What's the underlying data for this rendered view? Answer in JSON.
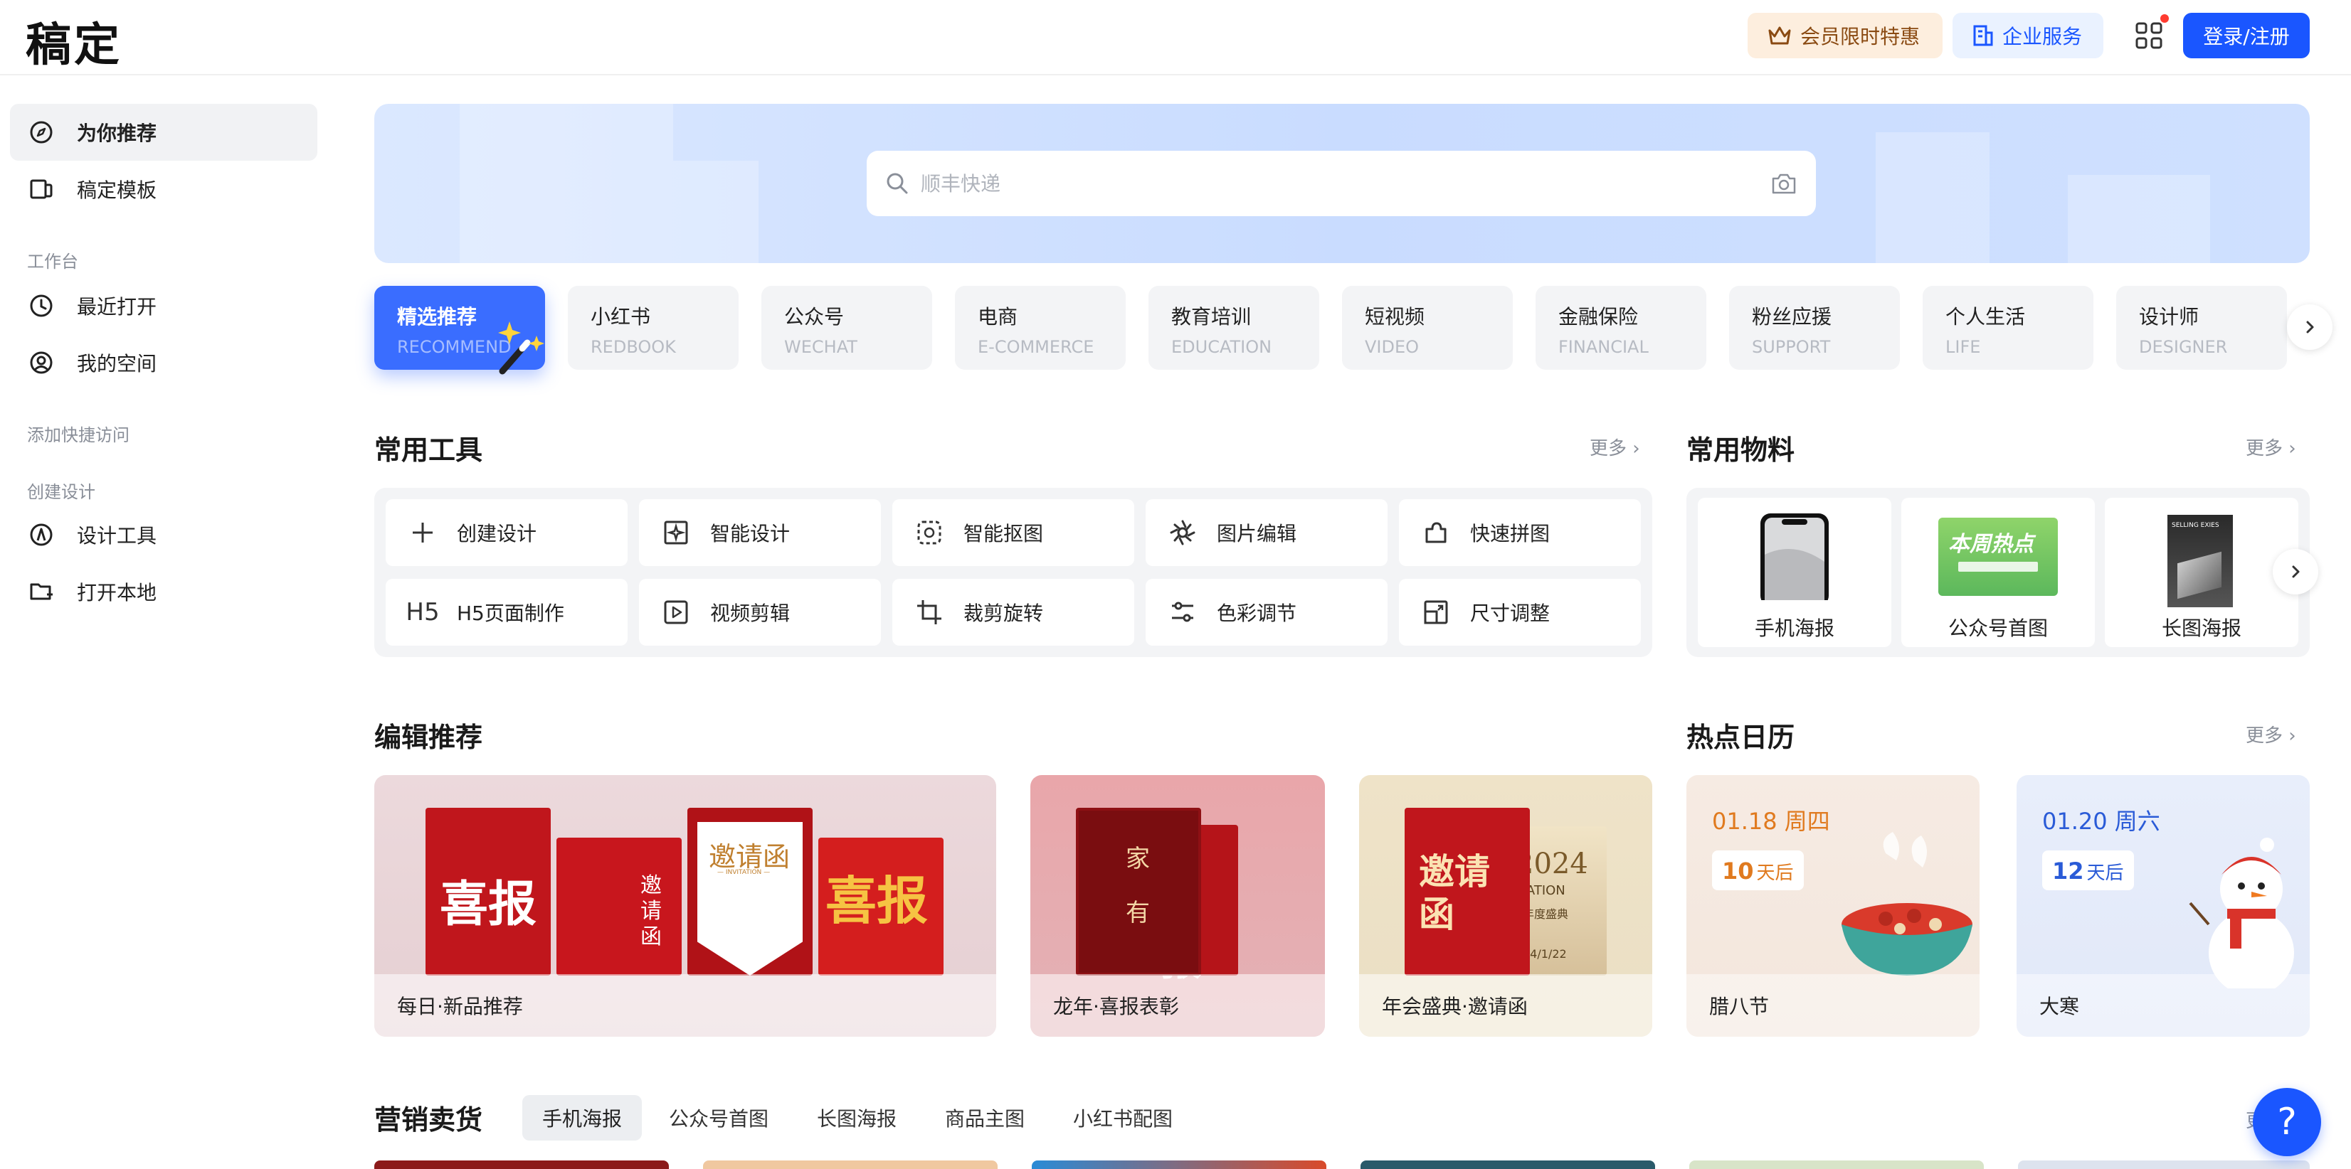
{
  "header": {
    "logo": "稿定",
    "vip_label": "会员限时特惠",
    "enterprise_label": "企业服务",
    "login_label": "登录/注册"
  },
  "sidebar": {
    "items_top": [
      {
        "label": "为你推荐",
        "icon": "compass-icon",
        "active": true
      },
      {
        "label": "稿定模板",
        "icon": "template-icon",
        "active": false
      }
    ],
    "section_workbench": "工作台",
    "items_workbench": [
      {
        "label": "最近打开",
        "icon": "clock-icon"
      },
      {
        "label": "我的空间",
        "icon": "user-circle-icon"
      }
    ],
    "section_quick": "添加快捷访问",
    "section_create": "创建设计",
    "items_create": [
      {
        "label": "设计工具",
        "icon": "pen-tool-icon"
      },
      {
        "label": "打开本地",
        "icon": "folder-add-icon"
      }
    ]
  },
  "search": {
    "placeholder": "顺丰快递"
  },
  "categories": [
    {
      "cn": "精选推荐",
      "en": "RECOMMEND",
      "active": true
    },
    {
      "cn": "小红书",
      "en": "REDBOOK"
    },
    {
      "cn": "公众号",
      "en": "WECHAT"
    },
    {
      "cn": "电商",
      "en": "E-COMMERCE"
    },
    {
      "cn": "教育培训",
      "en": "EDUCATION"
    },
    {
      "cn": "短视频",
      "en": "VIDEO"
    },
    {
      "cn": "金融保险",
      "en": "FINANCIAL"
    },
    {
      "cn": "粉丝应援",
      "en": "SUPPORT"
    },
    {
      "cn": "个人生活",
      "en": "LIFE"
    },
    {
      "cn": "设计师",
      "en": "DESIGNER"
    }
  ],
  "tools": {
    "title": "常用工具",
    "more": "更多",
    "items": [
      {
        "label": "创建设计",
        "icon": "plus-icon"
      },
      {
        "label": "智能设计",
        "icon": "ai-design-icon"
      },
      {
        "label": "智能抠图",
        "icon": "cutout-icon"
      },
      {
        "label": "图片编辑",
        "icon": "image-edit-icon"
      },
      {
        "label": "快速拼图",
        "icon": "puzzle-icon"
      },
      {
        "label": "H5页面制作",
        "icon": "h5-icon",
        "glyph": "H5"
      },
      {
        "label": "视频剪辑",
        "icon": "video-play-icon"
      },
      {
        "label": "裁剪旋转",
        "icon": "crop-icon"
      },
      {
        "label": "色彩调节",
        "icon": "sliders-icon"
      },
      {
        "label": "尺寸调整",
        "icon": "resize-icon"
      }
    ]
  },
  "materials": {
    "title": "常用物料",
    "more": "更多",
    "items": [
      "手机海报",
      "公众号首图",
      "长图海报"
    ],
    "thumb_texts": [
      "SELLING EXIES",
      "本周热点"
    ]
  },
  "editorial": {
    "title": "编辑推荐",
    "items": [
      "每日·新品推荐",
      "龙年·喜报表彰",
      "年会盛典·邀请函"
    ],
    "poster_texts": {
      "xibao": "喜报",
      "yaoqinghan": "邀请函",
      "yaoqing_short": "邀\n请\n函",
      "invitation": "— INVITATION —",
      "jia": "家",
      "you": "有",
      "year_2024": "2024",
      "itation": "ITATION",
      "nianduchengdian": "年度盛典",
      "date_short": "24/1/22"
    }
  },
  "hot": {
    "title": "热点日历",
    "more": "更多",
    "items": [
      {
        "date": "01.18 周四",
        "count": "10",
        "suffix": "天后",
        "name": "腊八节",
        "color": "#e07a1f"
      },
      {
        "date": "01.20 周六",
        "count": "12",
        "suffix": "天后",
        "name": "大寒",
        "color": "#2a5bd7"
      }
    ]
  },
  "marketing": {
    "title": "营销卖货",
    "tabs": [
      "手机海报",
      "公众号首图",
      "长图海报",
      "商品主图",
      "小红书配图"
    ],
    "more": "更"
  },
  "help": {
    "label": "?"
  },
  "colors": {
    "brand": "#1a56ff",
    "accent_red": "#c8161d"
  }
}
